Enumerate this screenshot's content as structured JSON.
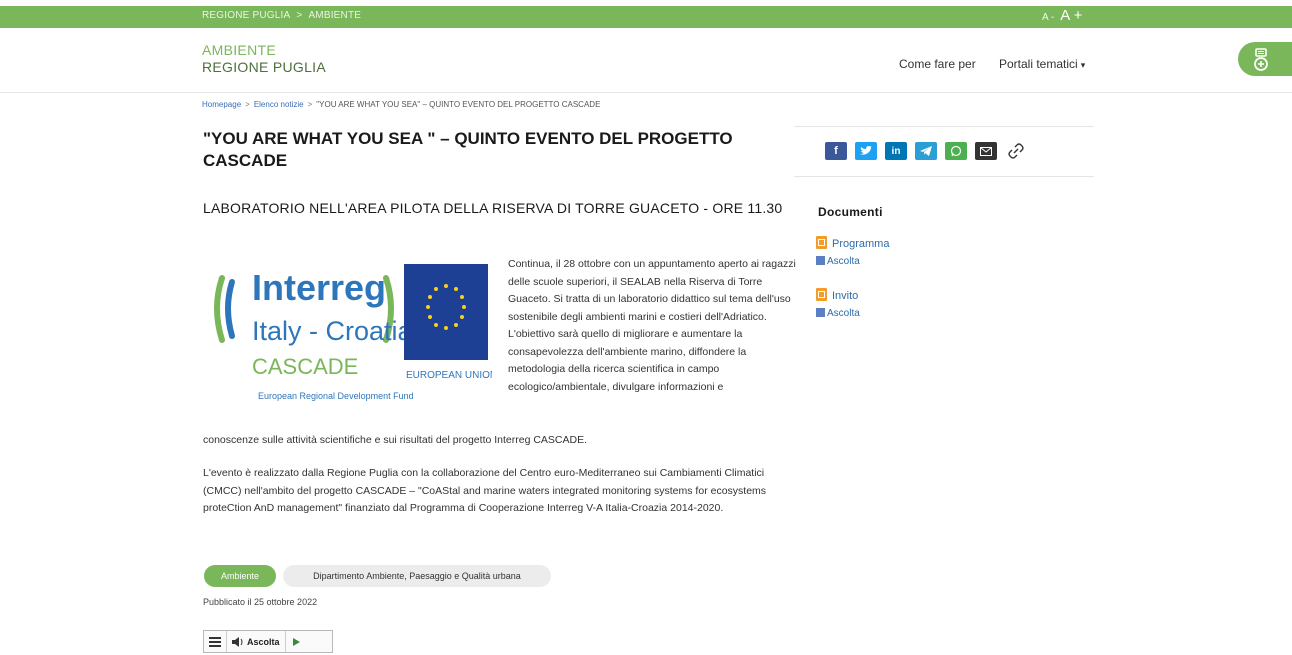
{
  "topbar": {
    "crumb1": "REGIONE PUGLIA",
    "sep": ">",
    "crumb2": "AMBIENTE",
    "font_small": "A -",
    "font_big": "A +"
  },
  "header": {
    "brand_line1": "AMBIENTE",
    "brand_line2": "REGIONE PUGLIA",
    "nav_how": "Come fare per",
    "nav_portals": "Portali tematici",
    "chevron": "▾"
  },
  "breadcrumb": {
    "home": "Homepage",
    "news": "Elenco notizie",
    "current": "\"YOU ARE WHAT YOU SEA\" – QUINTO EVENTO DEL PROGETTO CASCADE",
    "sep": ">"
  },
  "article": {
    "title": "\"YOU ARE WHAT YOU SEA \" – QUINTO EVENTO DEL PROGETTO CASCADE",
    "subtitle": "LABORATORIO NELL'AREA PILOTA DELLA RISERVA DI TORRE GUACETO - ORE 11.30",
    "paragraph1_wrap": "Continua, il 28 ottobre con un appuntamento aperto ai ragazzi delle scuole superiori, il SEALAB nella Riserva di Torre Guaceto. Si tratta di un laboratorio didattico sul tema dell'uso sostenibile degli ambienti marini e costieri dell'Adriatico. L'obiettivo sarà quello di migliorare e aumentare la consapevolezza dell'ambiente marino, diffondere la metodologia della ricerca scientifica in campo ecologico/ambientale, divulgare informazioni e",
    "paragraph1_rest": "conoscenze sulle attività scientifiche e sui risultati del progetto Interreg CASCADE.",
    "paragraph2": "L'evento è realizzato dalla Regione Puglia con la collaborazione del Centro euro-Mediterraneo sui Cambiamenti Climatici (CMCC) nell'ambito del progetto CASCADE – \"CoAStal and marine waters integrated monitoring systems for ecosystems proteCtion AnD management\" finanziato dal Programma di Cooperazione Interreg V-A Italia-Croazia 2014-2020.",
    "tag_primary": "Ambiente",
    "tag_secondary": "Dipartimento Ambiente, Paesaggio e Qualità urbana",
    "published": "Pubblicato il 25 ottobre 2022",
    "player_listen": "Ascolta"
  },
  "logo": {
    "line1": "Interreg",
    "line2": "Italy - Croatia",
    "line3": "CASCADE",
    "line4": "European Regional Development Fund",
    "eu": "EUROPEAN UNION"
  },
  "sidebar": {
    "share": [
      "f",
      "t",
      "in",
      "tg",
      "wa",
      "mail",
      "link"
    ],
    "docs_title": "Documenti",
    "docs": [
      {
        "label": "Programma",
        "listen": "Ascolta"
      },
      {
        "label": "Invito",
        "listen": "Ascolta"
      }
    ]
  },
  "colors": {
    "brand_green": "#7ab65a",
    "dark_green": "#4c6f3c",
    "facebook": "#3b5998",
    "twitter": "#1da1f2",
    "linkedin": "#0077b5",
    "telegram": "#2a9fd6",
    "whatsapp": "#4caf50"
  }
}
